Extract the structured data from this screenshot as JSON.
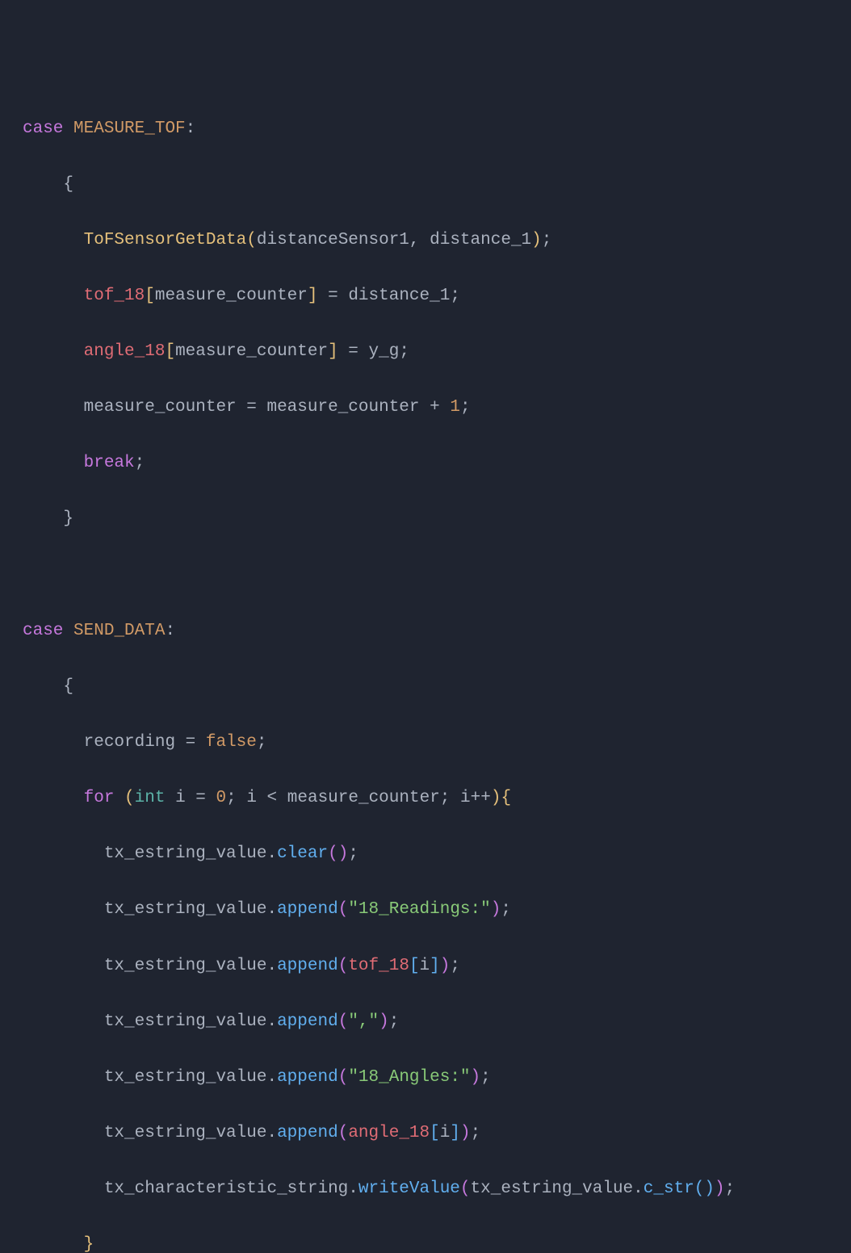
{
  "code": {
    "case1": {
      "kw_case": "case",
      "name": "MEASURE_TOF",
      "lines": {
        "l1": {
          "fn": "ToFSensorGetData",
          "arg1": "distanceSensor1",
          "arg2": "distance_1"
        },
        "l2": {
          "arr": "tof_18",
          "idx": "measure_counter",
          "rhs": "distance_1"
        },
        "l3": {
          "arr": "angle_18",
          "idx": "measure_counter",
          "rhs": "y_g"
        },
        "l4": {
          "lhs": "measure_counter",
          "rhs1": "measure_counter",
          "op_plus": "+",
          "rhs2": "1"
        },
        "l5": {
          "kw": "break"
        }
      }
    },
    "case2": {
      "kw_case": "case",
      "name": "SEND_DATA",
      "lines": {
        "l1": {
          "lhs": "recording",
          "rhs": "false"
        },
        "l2": {
          "kw": "for",
          "type": "int",
          "var": "i",
          "init": "0",
          "cond_var": "i",
          "op_lt": "<",
          "cond_rhs": "measure_counter",
          "inc_var": "i",
          "op_inc": "++"
        },
        "l3": {
          "obj": "tx_estring_value",
          "method": "clear"
        },
        "l4": {
          "obj": "tx_estring_value",
          "method": "append",
          "arg_str": "\"18_Readings:\""
        },
        "l5": {
          "obj": "tx_estring_value",
          "method": "append",
          "arg_arr": "tof_18",
          "arg_idx": "i"
        },
        "l6": {
          "obj": "tx_estring_value",
          "method": "append",
          "arg_str": "\",\""
        },
        "l7": {
          "obj": "tx_estring_value",
          "method": "append",
          "arg_str": "\"18_Angles:\""
        },
        "l8": {
          "obj": "tx_estring_value",
          "method": "append",
          "arg_arr": "angle_18",
          "arg_idx": "i"
        },
        "l9": {
          "obj": "tx_characteristic_string",
          "method": "writeValue",
          "arg_obj": "tx_estring_value",
          "arg_method": "c_str"
        }
      }
    },
    "ops": {
      "eq": " = ",
      "semi": ";",
      "colon": ":",
      "dot": ".",
      "comma": ", ",
      "lbrace": "{",
      "rbrace": "}",
      "lparen": "(",
      "rparen": ")",
      "lbrack": "[",
      "rbrack": "]"
    }
  }
}
